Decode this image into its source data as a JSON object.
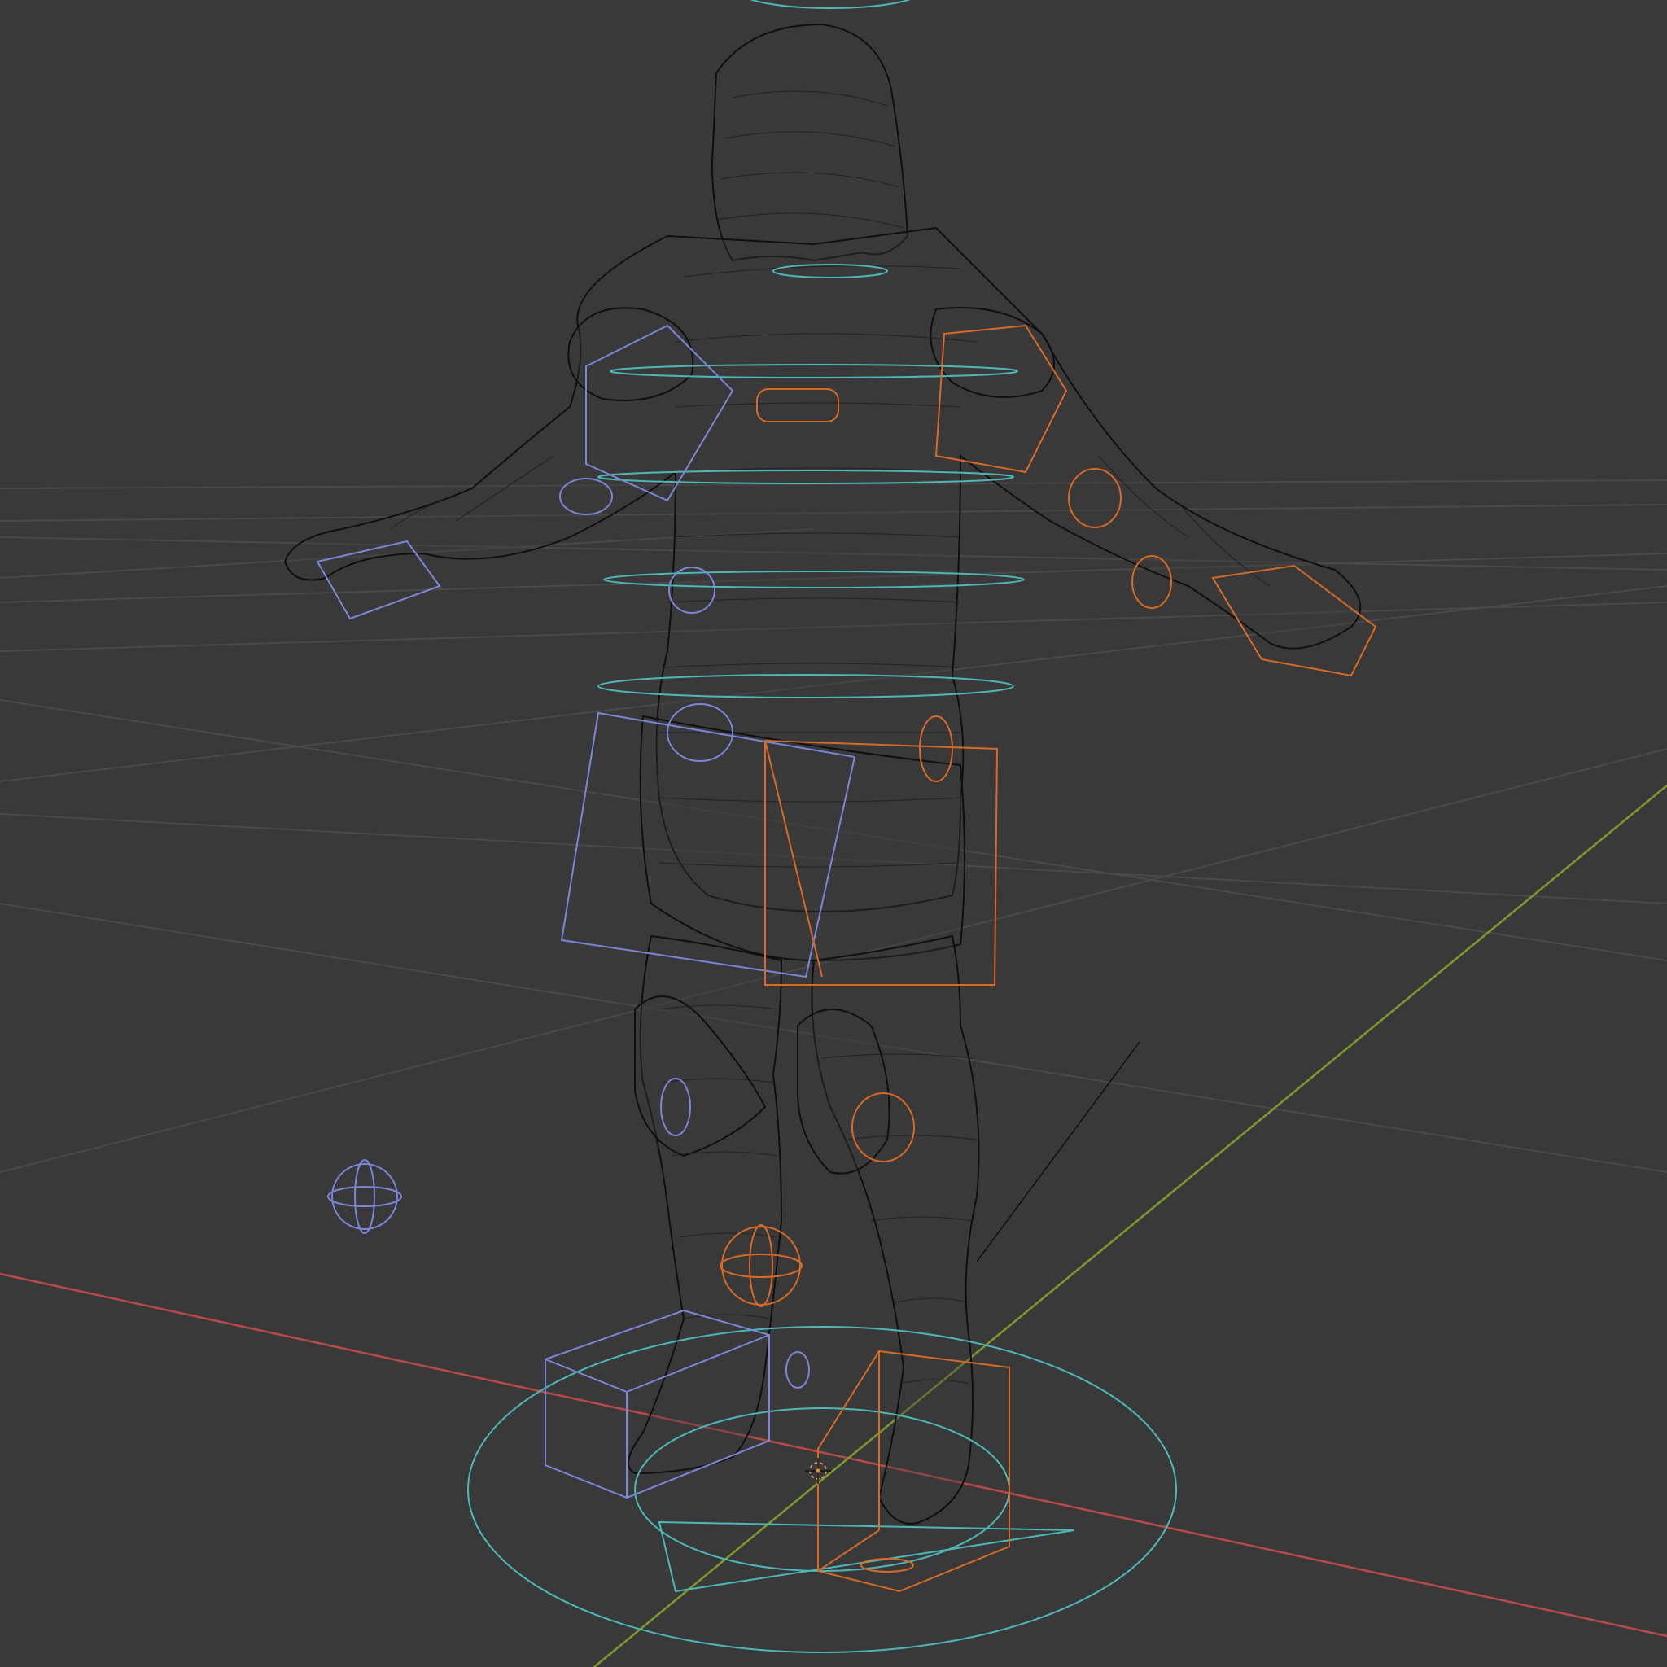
{
  "viewport": {
    "mode": "wireframe",
    "background_color": "#393939"
  },
  "grid": {
    "line_color": "#4a4a4a",
    "x_axis_color": "#b84a4a",
    "y_axis_color": "#7f9a2c"
  },
  "scene": {
    "mesh": {
      "description_icon": "character-mesh-icon",
      "wire_color": "#0f0f0f"
    },
    "rig": {
      "left_side_color": "#7a86d8",
      "right_side_color": "#d86a25",
      "center_color": "#4db8b8"
    },
    "cursor": {
      "icon": "3d-cursor-icon"
    }
  }
}
